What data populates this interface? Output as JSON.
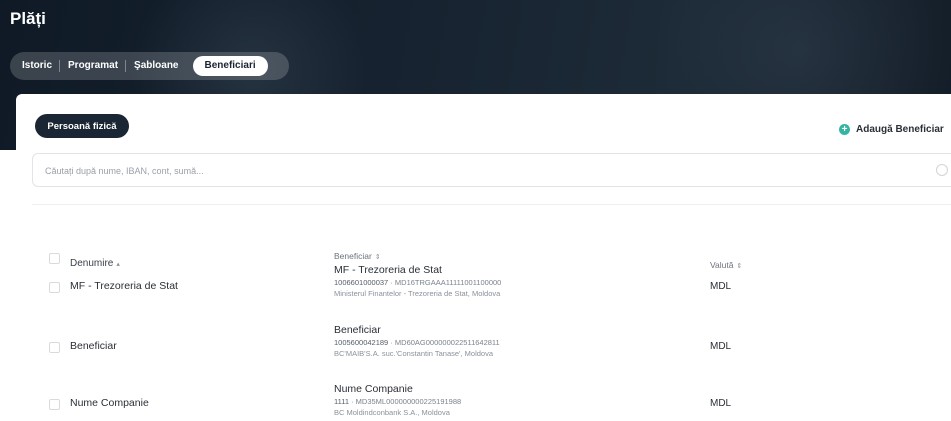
{
  "page": {
    "title": "Plăți"
  },
  "tabs": [
    {
      "label": "Istoric",
      "active": false
    },
    {
      "label": "Programat",
      "active": false
    },
    {
      "label": "Şabloane",
      "active": false
    },
    {
      "label": "Beneficiari",
      "active": true
    }
  ],
  "toolbar": {
    "person_filter_label": "Persoană fizică",
    "add_beneficiary_label": "Adaugă Beneficiar",
    "add_icon": "plus-circle-icon"
  },
  "search": {
    "placeholder": "Căutați după nume, IBAN, cont, sumă...",
    "value": ""
  },
  "table": {
    "headers": {
      "name": "Denumire",
      "name_sort_icon": "▴",
      "beneficiary": "Beneficiar",
      "beneficiary_sort_icon": "⇕",
      "currency": "Valută",
      "currency_sort_icon": "⇕"
    },
    "rows": [
      {
        "name": "MF - Trezoreria de Stat",
        "beneficiary_name": "MF - Trezoreria de Stat",
        "account": "1006601000037",
        "iban": " · MD16TRGAAA11111001100000",
        "bank": "Ministerul Finantelor - Trezoreria de Stat, Moldova",
        "currency": "MDL"
      },
      {
        "name": "Beneficiar",
        "beneficiary_name": "Beneficiar",
        "account": "1005600042189",
        "iban": " · MD60AG000000022511642811",
        "bank": "BC'MAIB'S.A. suc.'Constantin Tanase', Moldova",
        "currency": "MDL"
      },
      {
        "name": "Nume Companie",
        "beneficiary_name": "Nume Companie",
        "account": "1111",
        "iban": " · MD35ML000000000225191988",
        "bank": "BC Moldindconbank S.A., Moldova",
        "currency": "MDL"
      }
    ]
  },
  "colors": {
    "accent_teal": "#34b5a4",
    "dark_button": "#1b2634",
    "hero_bg": "#16222f"
  }
}
